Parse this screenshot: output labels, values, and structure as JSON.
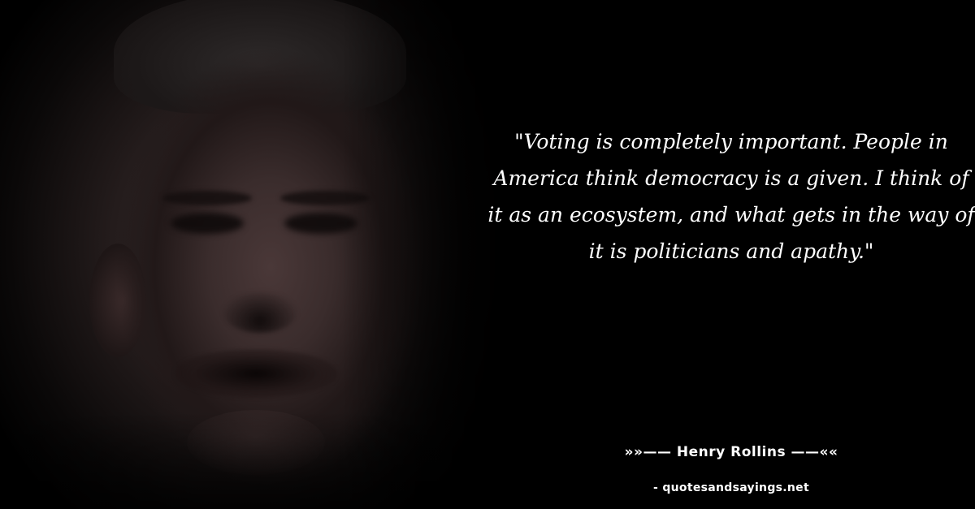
{
  "quote": {
    "text": "\"Voting is completely important. People in America think democracy is a given. I think of it as an ecosystem, and what gets in the way of it is politicians and apathy.\""
  },
  "author": {
    "line": "»»—— Henry Rollins ——««"
  },
  "source": {
    "line": "- quotesandsayings.net"
  },
  "colors": {
    "background": "#000000",
    "text": "#ffffff"
  }
}
